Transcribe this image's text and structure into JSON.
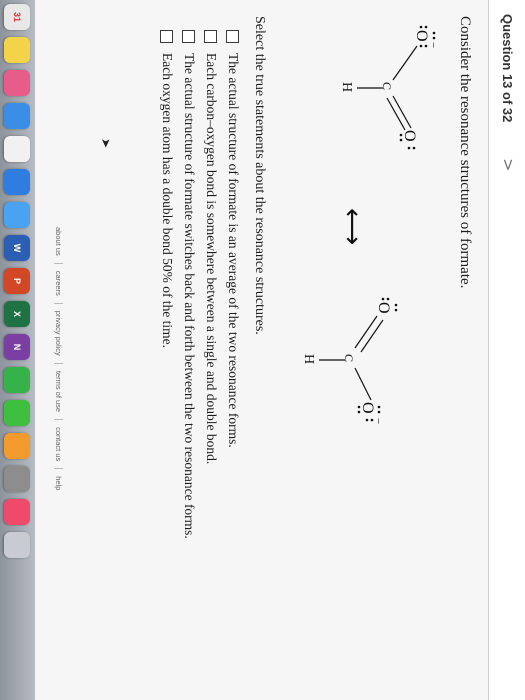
{
  "header": {
    "question_counter": "Question 13 of 32",
    "next_symbol": ">"
  },
  "prompt": "Consider the resonance structures of formate.",
  "structures": {
    "atom_O": "O",
    "atom_C": "C",
    "atom_H": "H",
    "charge": "−",
    "arrow": "⟷"
  },
  "instruction": "Select the true statements about the resonance structures.",
  "options": [
    {
      "label": "The actual structure of formate is an average of the two resonance forms.",
      "checked": false
    },
    {
      "label": "Each carbon–oxygen bond is somewhere between a single and double bond.",
      "checked": false
    },
    {
      "label": "The actual structure of formate switches back and forth between the two resonance forms.",
      "checked": false
    },
    {
      "label": "Each oxygen atom has a double bond 50% of the time.",
      "checked": false
    }
  ],
  "footer": {
    "links": [
      "about us",
      "careers",
      "privacy policy",
      "terms of use",
      "contact us",
      "help"
    ]
  },
  "dock": {
    "icons": [
      {
        "name": "calendar-icon",
        "color": "#e8e8e8",
        "text": "31"
      },
      {
        "name": "notes-icon",
        "color": "#f3d34a",
        "text": ""
      },
      {
        "name": "photos-icon",
        "color": "#e85c8a",
        "text": ""
      },
      {
        "name": "appstore-icon",
        "color": "#3a8ee6",
        "text": ""
      },
      {
        "name": "reminders-icon",
        "color": "#f1f1f1",
        "text": ""
      },
      {
        "name": "browser-icon",
        "color": "#2f7de1",
        "text": ""
      },
      {
        "name": "mail-icon",
        "color": "#4aa3f0",
        "text": ""
      },
      {
        "name": "word-icon",
        "color": "#2b5fb4",
        "text": "W"
      },
      {
        "name": "powerpoint-icon",
        "color": "#d24726",
        "text": "P"
      },
      {
        "name": "excel-icon",
        "color": "#1f7244",
        "text": "X"
      },
      {
        "name": "onenote-icon",
        "color": "#7b3fa3",
        "text": "N"
      },
      {
        "name": "facetime-icon",
        "color": "#35b34a",
        "text": ""
      },
      {
        "name": "messages-icon",
        "color": "#3fbf3f",
        "text": ""
      },
      {
        "name": "ibooks-icon",
        "color": "#f29a2e",
        "text": ""
      },
      {
        "name": "settings-icon",
        "color": "#8d8d8d",
        "text": ""
      },
      {
        "name": "music-icon",
        "color": "#f04a6a",
        "text": ""
      },
      {
        "name": "trash-icon",
        "color": "#c8ccd2",
        "text": ""
      }
    ]
  }
}
